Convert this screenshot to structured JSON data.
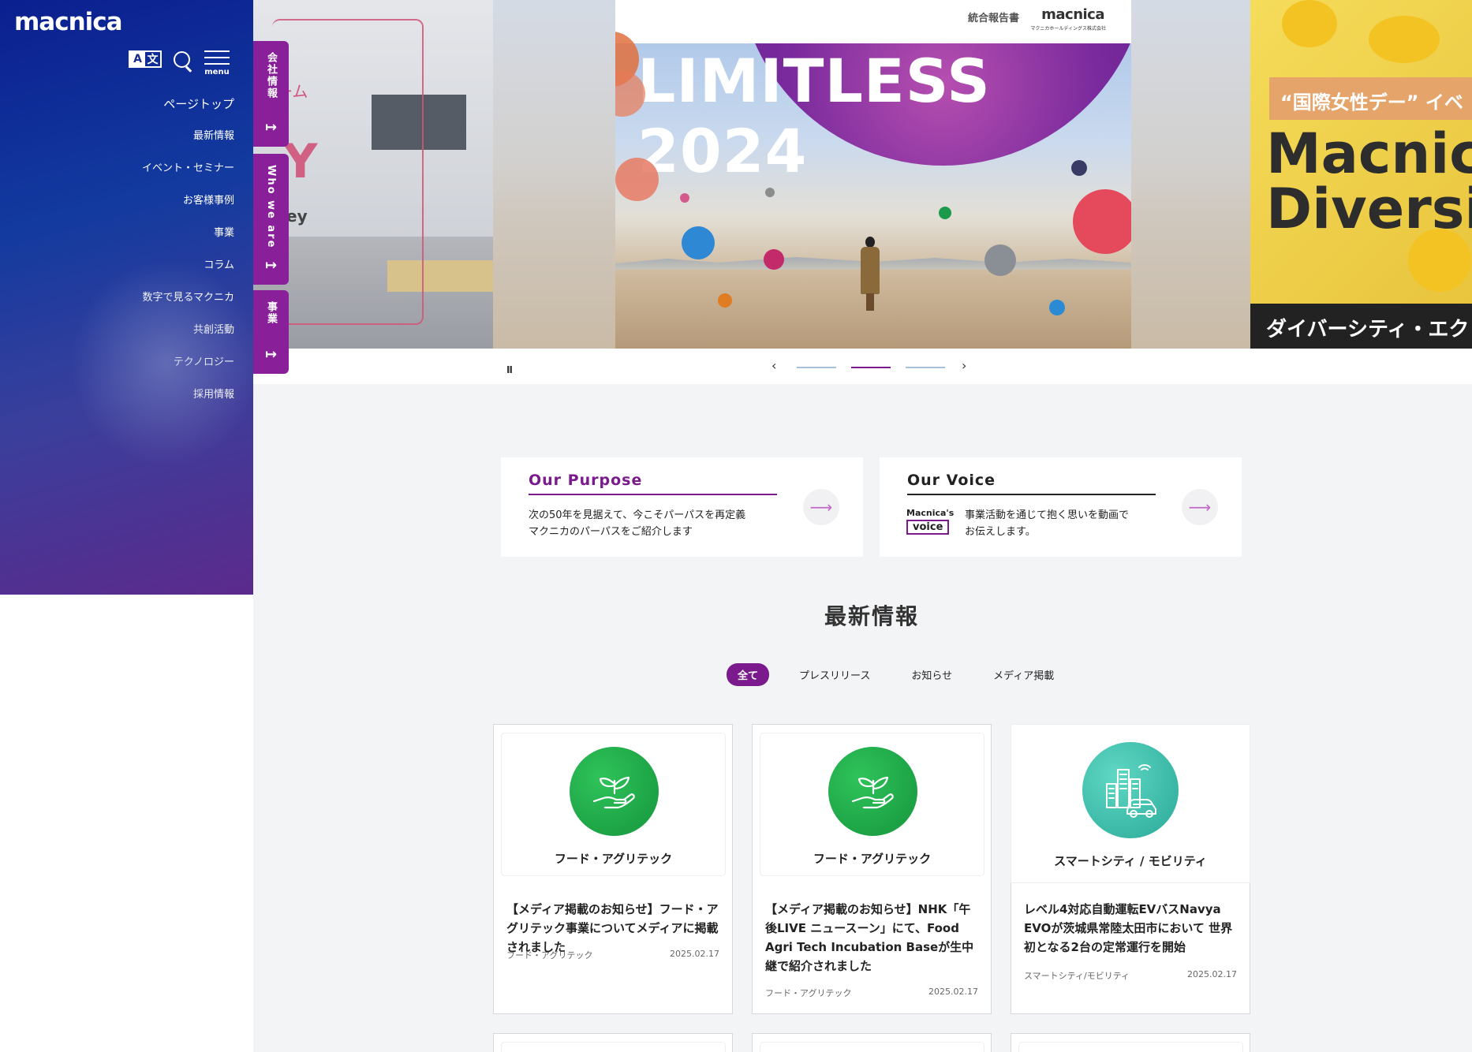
{
  "sidebar": {
    "logo": "macnica",
    "lang_icon": [
      "A",
      "文"
    ],
    "menu_label": "menu",
    "nav": [
      "ページトップ",
      "最新情報",
      "イベント・セミナー",
      "お客様事例",
      "事業",
      "コラム",
      "数字で見るマクニカ",
      "共創活動",
      "テクノロジー",
      "採用情報"
    ]
  },
  "side_tabs": [
    "会社情報",
    "Who we are",
    "事業"
  ],
  "hero": {
    "left_slide": {
      "text1": "ーム",
      "big_letter": "Y",
      "text2": "ey"
    },
    "main_slide": {
      "report_label": "統合報告書",
      "brand": "macnica",
      "brand_sub": "マクニカホールディングス株式会社",
      "headline": "LIMITLESS 2024"
    },
    "right_slide": {
      "pill": "“国際女性デー” イベ",
      "big": "Macnic\nDiversit",
      "band": "ダイバーシティ・エク"
    }
  },
  "slider": {
    "pause_icon": "II",
    "prev": "‹",
    "next": "›",
    "active_index": 1,
    "count": 3
  },
  "purpose_cards": [
    {
      "title": "Our Purpose",
      "accent": "#7a1a8c",
      "desc_line1": "次の50年を見据えて、今こそパーパスを再定義",
      "desc_line2": "マクニカのパーパスをご紹介します",
      "arrow": "⟶"
    },
    {
      "title": "Our Voice",
      "accent": "#222222",
      "badge_top": "Macnica's",
      "badge_bottom": "voice",
      "desc_line1": "事業活動を通じて抱く思いを動画で",
      "desc_line2": "お伝えします。",
      "arrow": "⟶"
    }
  ],
  "news": {
    "title": "最新情報",
    "filters": [
      "全て",
      "プレスリリース",
      "お知らせ",
      "メディア掲載"
    ],
    "active_filter": 0,
    "cards": [
      {
        "icon": "plant-hand-icon",
        "icon_color": "#22a84a",
        "category_label": "フード・アグリテック",
        "title": "【メディア掲載のお知らせ】フード・アグリテック事業についてメディアに掲載されました",
        "category": "フード・アグリテック",
        "date": "2025.02.17"
      },
      {
        "icon": "plant-hand-icon",
        "icon_color": "#22a84a",
        "category_label": "フード・アグリテック",
        "title": "【メディア掲載のお知らせ】NHK「午後LIVE ニュースーン」にて、Food Agri Tech Incubation Baseが生中継で紹介されました",
        "category": "フード・アグリテック",
        "date": "2025.02.17"
      },
      {
        "icon": "smart-city-icon",
        "icon_color": "#3dbfb0",
        "category_label": "スマートシティ / モビリティ",
        "title": "レベル4対応自動運転EVバスNavya EVOが茨城県常陸太田市において 世界初となる2台の定常運行を開始",
        "category": "スマートシティ/モビリティ",
        "date": "2025.02.17"
      }
    ]
  }
}
